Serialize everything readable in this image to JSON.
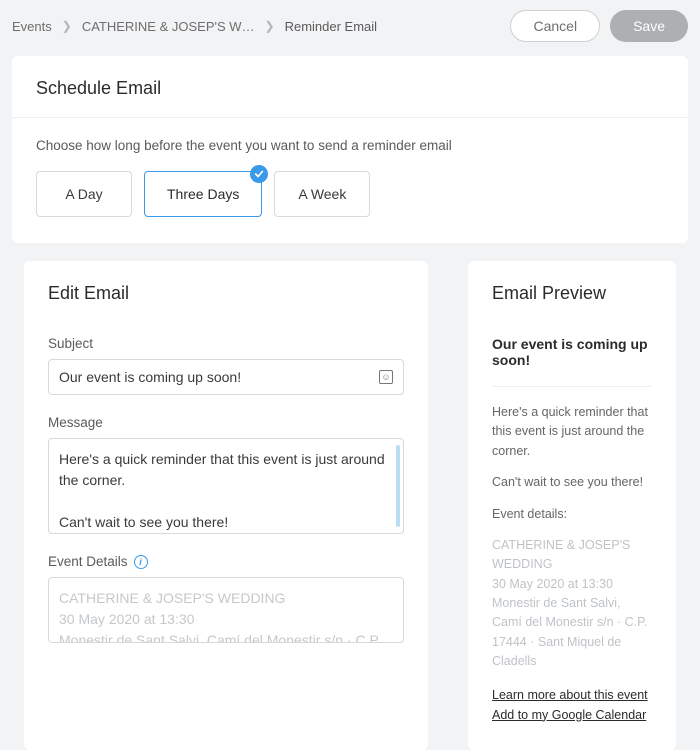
{
  "breadcrumb": {
    "item1": "Events",
    "item2": "CATHERINE & JOSEP'S W…",
    "item3": "Reminder Email"
  },
  "actions": {
    "cancel": "Cancel",
    "save": "Save"
  },
  "schedule": {
    "title": "Schedule Email",
    "description": "Choose how long before the event you want to send a reminder email",
    "options": {
      "day": "A Day",
      "threeDays": "Three Days",
      "week": "A Week"
    }
  },
  "edit": {
    "title": "Edit Email",
    "subjectLabel": "Subject",
    "subjectValue": "Our event is coming up soon!",
    "messageLabel": "Message",
    "messageValue": "Here's a quick reminder that this event is just around the corner.\n\nCan't wait to see you there!",
    "detailsLabel": "Event Details",
    "detailsLine1": "CATHERINE & JOSEP'S WEDDING",
    "detailsLine2": "30 May 2020 at 13:30",
    "detailsLine3": "Monestir de Sant Salvi, Camí del Monestir s/n · C.P."
  },
  "preview": {
    "title": "Email Preview",
    "subject": "Our event is coming up soon!",
    "body1": "Here's a quick reminder that this event is just around the corner.",
    "body2": "Can't wait to see you there!",
    "body3": "Event details:",
    "detailsLine1": "CATHERINE & JOSEP'S WEDDING",
    "detailsLine2": "30 May 2020 at 13:30",
    "detailsLine3": "Monestir de Sant Salvi, Camí del Monestir s/n · C.P. 17444 · Sant Miquel de Cladells",
    "link1": "Learn more about this event",
    "link2": "Add to my Google Calendar"
  }
}
